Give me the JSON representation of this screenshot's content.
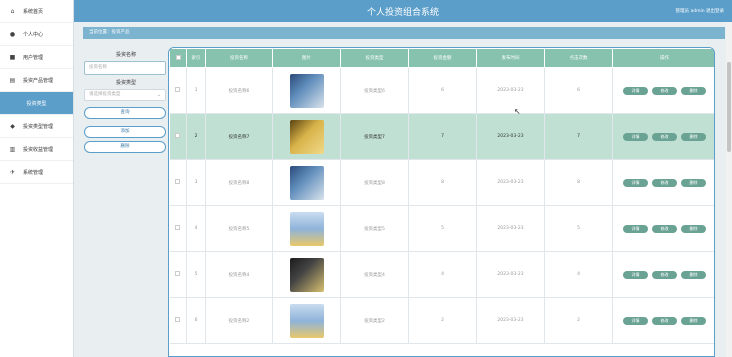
{
  "header": {
    "title": "个人投资组合系统",
    "user": "管理员 admin 退出登录"
  },
  "breadcrumb": "当前位置：投资产品",
  "sidebar": {
    "items": [
      {
        "label": "系统首页",
        "icon": "⌂",
        "iconName": "home-icon"
      },
      {
        "label": "个人中心",
        "icon": "●",
        "iconName": "user-icon"
      },
      {
        "label": "用户管理",
        "icon": "■",
        "iconName": "users-icon"
      },
      {
        "label": "投资产品管理",
        "icon": "▤",
        "iconName": "product-icon"
      },
      {
        "label": "投资类型",
        "icon": "",
        "iconName": ""
      },
      {
        "label": "投资类型管理",
        "icon": "◆",
        "iconName": "type-icon"
      },
      {
        "label": "投资收益管理",
        "icon": "▥",
        "iconName": "chart-icon"
      },
      {
        "label": "系统管理",
        "icon": "✈",
        "iconName": "settings-icon"
      }
    ]
  },
  "search": {
    "name_label": "投资名称",
    "name_placeholder": "投资名称",
    "type_label": "投资类型",
    "type_placeholder": "请选择投资类型",
    "buttons": [
      "查询",
      "添加",
      "删除"
    ]
  },
  "table": {
    "headers": [
      "",
      "索引",
      "投资名称",
      "图片",
      "投资类型",
      "投资金额",
      "发布时间",
      "点击次数",
      "操作"
    ],
    "ops": [
      "详情",
      "修改",
      "删除"
    ],
    "rows": [
      {
        "idx": "1",
        "name": "投资名称6",
        "img": "a",
        "type": "投资类型6",
        "amount": "6",
        "date": "2023-03-23",
        "clicks": "6"
      },
      {
        "idx": "2",
        "name": "投资名称7",
        "img": "b",
        "type": "投资类型7",
        "amount": "7",
        "date": "2023-03-23",
        "clicks": "7"
      },
      {
        "idx": "3",
        "name": "投资名称8",
        "img": "a",
        "type": "投资类型8",
        "amount": "8",
        "date": "2023-03-23",
        "clicks": "8"
      },
      {
        "idx": "4",
        "name": "投资名称5",
        "img": "c",
        "type": "投资类型5",
        "amount": "5",
        "date": "2023-03-23",
        "clicks": "5"
      },
      {
        "idx": "5",
        "name": "投资名称4",
        "img": "d",
        "type": "投资类型4",
        "amount": "4",
        "date": "2023-03-23",
        "clicks": "4"
      },
      {
        "idx": "6",
        "name": "投资名称2",
        "img": "c",
        "type": "投资类型2",
        "amount": "2",
        "date": "2023-03-23",
        "clicks": "2"
      }
    ]
  },
  "colors": {
    "primary": "#5b9ec9",
    "tableHeader": "#86c2ad",
    "highlight": "#bfe0d2",
    "opButton": "#6aa393"
  }
}
